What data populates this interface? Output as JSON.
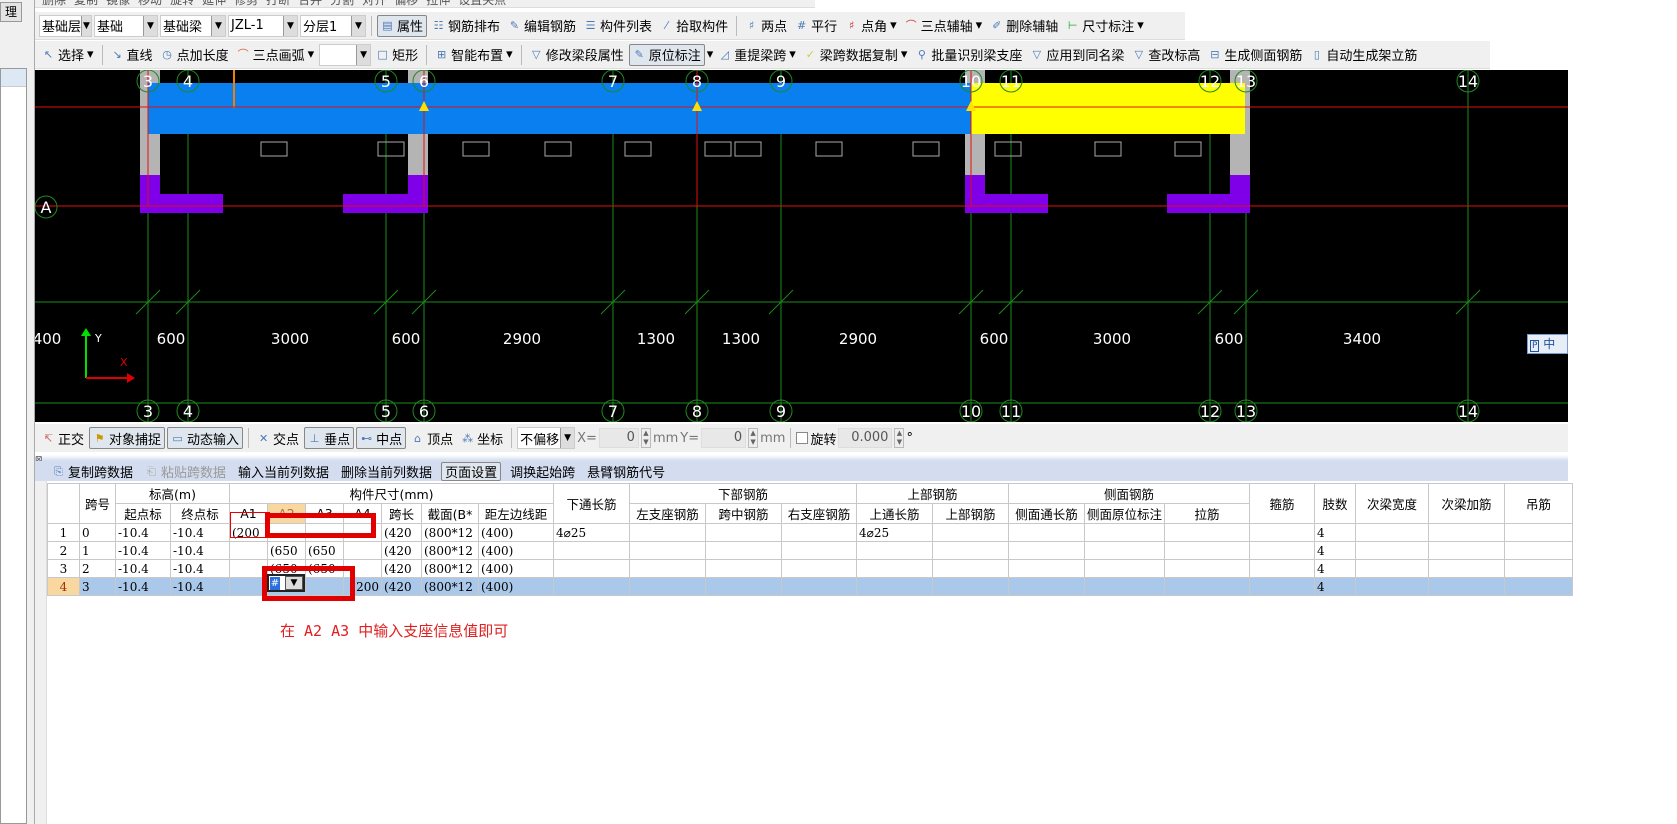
{
  "left_panel": {
    "tab_label": "理"
  },
  "toolbar_top": {
    "items": [
      "删除",
      "复制",
      "镜像",
      "移动",
      "旋转",
      "延伸",
      "修剪",
      "打断",
      "合并",
      "分割",
      "对齐",
      "偏移",
      "拉伸",
      "设置夹点"
    ]
  },
  "toolbar_1": {
    "combos": [
      {
        "value": "基础层"
      },
      {
        "value": "基础"
      },
      {
        "value": "基础梁"
      },
      {
        "value": "JZL-1"
      },
      {
        "value": "分层1"
      }
    ],
    "buttons": [
      "属性",
      "钢筋排布",
      "编辑钢筋",
      "构件列表",
      "拾取构件"
    ],
    "axis_buttons": [
      "两点",
      "平行",
      "点角",
      "三点辅轴",
      "删除辅轴",
      "尺寸标注"
    ]
  },
  "toolbar_2": {
    "buttons": [
      "选择",
      "直线",
      "点加长度",
      "三点画弧",
      "矩形",
      "智能布置",
      "修改梁段属性",
      "原位标注",
      "重提梁跨",
      "梁跨数据复制",
      "批量识别梁支座",
      "应用到同名梁",
      "查改标高",
      "生成侧面钢筋",
      "自动生成架立筋"
    ]
  },
  "cad": {
    "axes_top": [
      "3",
      "4",
      "5",
      "6",
      "7",
      "8",
      "9",
      "10",
      "11",
      "12",
      "13",
      "14"
    ],
    "axes_bottom": [
      "3",
      "4",
      "5",
      "6",
      "7",
      "8",
      "9",
      "10",
      "11",
      "12",
      "13",
      "14"
    ],
    "row_axis": "A",
    "dimensions": [
      "400",
      "600",
      "3000",
      "600",
      "2900",
      "1300",
      "1300",
      "2900",
      "600",
      "3000",
      "600",
      "3400"
    ],
    "ucs": {
      "x": "X",
      "y": "Y"
    },
    "colors": {
      "beam": "#0a7ff0",
      "beam_selected": "#ffff00",
      "column": "#b4b4b4",
      "pedestal": "#7f00e8",
      "axis": "#1e8a1e",
      "grid_red": "#e01010"
    }
  },
  "ime_indicator": "中",
  "status_bar": {
    "toggles": [
      "正交",
      "对象捕捉",
      "动态输入"
    ],
    "snaps": [
      "交点",
      "垂点",
      "中点",
      "顶点",
      "坐标"
    ],
    "offset_mode": "不偏移",
    "x_label": "X=",
    "x_value": "0",
    "x_unit": "mm",
    "y_label": "Y=",
    "y_value": "0",
    "y_unit": "mm",
    "rotate_label": "旋转",
    "rotate_value": "0.000",
    "degree": "°"
  },
  "grid_toolbar": {
    "buttons": [
      "复制跨数据",
      "粘贴跨数据",
      "输入当前列数据",
      "删除当前列数据",
      "页面设置",
      "调换起始跨",
      "悬臂钢筋代号"
    ]
  },
  "grid": {
    "group_headers": {
      "span_no": "跨号",
      "elevation": "标高(m)",
      "size": "构件尺寸(mm)",
      "bottom_long": "下通长筋",
      "bottom": "下部钢筋",
      "top": "上部钢筋",
      "side": "侧面钢筋",
      "stirrup": "箍筋",
      "legs": "肢数",
      "sec_width": "次梁宽度",
      "sec_add": "次梁加筋",
      "hanger": "吊筋"
    },
    "sub_headers": [
      "起点标",
      "终点标",
      "A1",
      "A2",
      "A3",
      "A4",
      "跨长",
      "截面(B*",
      "距左边线距",
      "左支座钢筋",
      "跨中钢筋",
      "右支座钢筋",
      "上通长筋",
      "上部钢筋",
      "侧面通长筋",
      "侧面原位标注",
      "拉筋"
    ],
    "rows": [
      {
        "n": "1",
        "span": "0",
        "start": "-10.4",
        "end": "-10.4",
        "a1": "(200",
        "a2": "",
        "a3": "",
        "a4": "",
        "len": "(420",
        "sec": "(800*12",
        "dist": "(400)",
        "bl": "4⌀25",
        "tl": "4⌀25",
        "legs": "4"
      },
      {
        "n": "2",
        "span": "1",
        "start": "-10.4",
        "end": "-10.4",
        "a1": "",
        "a2": "(650",
        "a3": "(650",
        "a4": "",
        "len": "(420",
        "sec": "(800*12",
        "dist": "(400)",
        "bl": "",
        "tl": "",
        "legs": "4"
      },
      {
        "n": "3",
        "span": "2",
        "start": "-10.4",
        "end": "-10.4",
        "a1": "",
        "a2": "(650",
        "a3": "(650",
        "a4": "",
        "len": "(420",
        "sec": "(800*12",
        "dist": "(400)",
        "bl": "",
        "tl": "",
        "legs": "4"
      },
      {
        "n": "4",
        "span": "3",
        "start": "-10.4",
        "end": "-10.4",
        "a1": "",
        "a2": "#",
        "a3": "",
        "a4": "200",
        "len": "(420",
        "sec": "(800*12",
        "dist": "(400)",
        "bl": "",
        "tl": "",
        "legs": "4"
      }
    ]
  },
  "annotation": "在 A2 A3 中输入支座信息值即可"
}
